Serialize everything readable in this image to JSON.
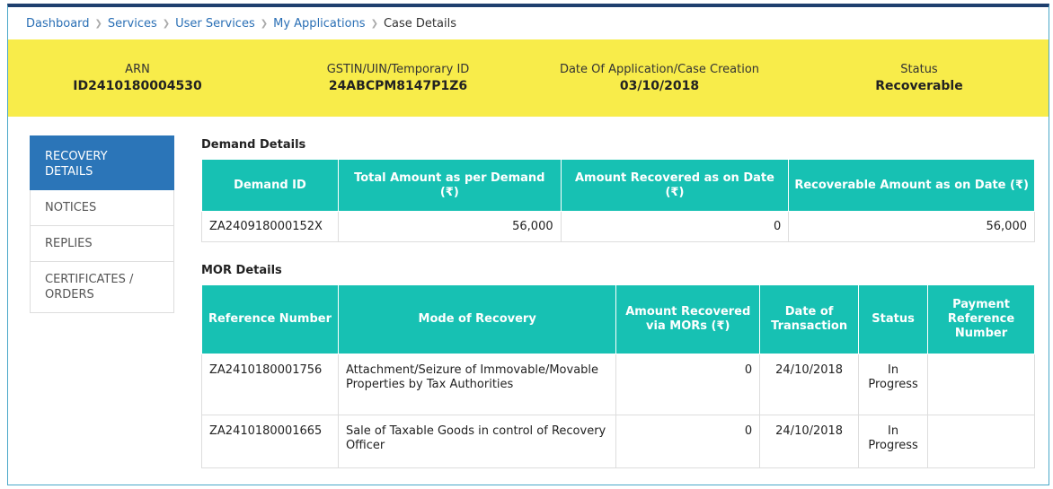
{
  "breadcrumb": {
    "items": [
      "Dashboard",
      "Services",
      "User Services",
      "My Applications"
    ],
    "current": "Case Details"
  },
  "info": {
    "arn_label": "ARN",
    "arn_value": "ID2410180004530",
    "gstin_label": "GSTIN/UIN/Temporary ID",
    "gstin_value": "24ABCPM8147P1Z6",
    "date_label": "Date Of Application/Case Creation",
    "date_value": "03/10/2018",
    "status_label": "Status",
    "status_value": "Recoverable"
  },
  "sidebar": {
    "items": [
      {
        "label": "RECOVERY DETAILS"
      },
      {
        "label": "NOTICES"
      },
      {
        "label": "REPLIES"
      },
      {
        "label": "CERTIFICATES / ORDERS"
      }
    ]
  },
  "demand": {
    "title": "Demand Details",
    "headers": [
      "Demand ID",
      "Total Amount as per Demand (₹)",
      "Amount Recovered as on Date (₹)",
      "Recoverable Amount as on Date (₹)"
    ],
    "rows": [
      [
        "ZA240918000152X",
        "56,000",
        "0",
        "56,000"
      ]
    ]
  },
  "mor": {
    "title": "MOR Details",
    "headers": [
      "Reference Number",
      "Mode of Recovery",
      "Amount Recovered via MORs (₹)",
      "Date of Transaction",
      "Status",
      "Payment Reference Number"
    ],
    "rows": [
      [
        "ZA2410180001756",
        "Attachment/Seizure of Immovable/Movable Properties by Tax Authorities",
        "0",
        "24/10/2018",
        "In Progress",
        ""
      ],
      [
        "ZA2410180001665",
        "Sale of Taxable Goods in control of Recovery Officer",
        "0",
        "24/10/2018",
        "In Progress",
        ""
      ]
    ]
  }
}
